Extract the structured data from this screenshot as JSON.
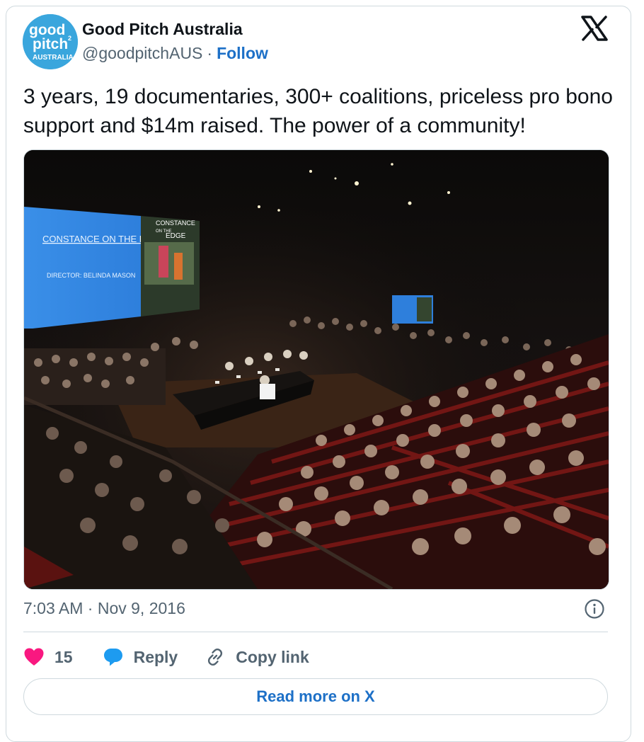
{
  "author": {
    "avatar_text_line1": "good",
    "avatar_text_line2": "pitch",
    "avatar_text_line3": "AUSTRALIA",
    "avatar_superscript": "2",
    "display_name": "Good Pitch Australia",
    "handle": "@goodpitchAUS",
    "separator": "·",
    "follow_label": "Follow",
    "brand_color": "#3aa6dd"
  },
  "tweet": {
    "text": "3 years, 19 documentaries, 300+ coalitions, priceless pro bono support and $14m raised. The power of a community!"
  },
  "media": {
    "screen_title": "CONSTANCE ON THE EDGE",
    "screen_director": "DIRECTOR: BELINDA MASON",
    "poster_title_line1": "CONSTANCE",
    "poster_title_line2": "ON THE",
    "poster_title_line3": "EDGE"
  },
  "meta": {
    "time": "7:03 AM",
    "separator": "·",
    "date": "Nov 9, 2016"
  },
  "actions": {
    "like_count": "15",
    "reply_label": "Reply",
    "copy_link_label": "Copy link"
  },
  "footer": {
    "read_more_label": "Read more on X"
  },
  "colors": {
    "link_blue": "#1d70c7",
    "heart_pink": "#f91880",
    "reply_blue": "#1d9bf0",
    "secondary_text": "#536471"
  }
}
